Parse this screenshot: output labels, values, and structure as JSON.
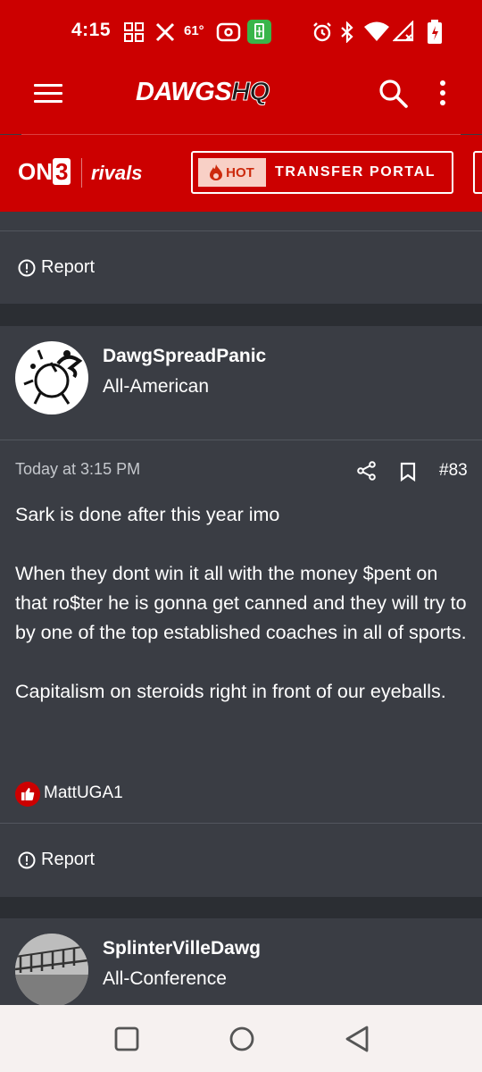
{
  "status_bar": {
    "time": "4:15",
    "temperature": "61°"
  },
  "app_bar": {
    "logo_main": "DAWGS",
    "logo_accent": "HQ"
  },
  "brand_bar": {
    "on3_prefix": "ON",
    "on3_number": "3",
    "rivals": "rivals",
    "hot_label": "HOT",
    "transfer_portal_label": "TRANSFER PORTAL"
  },
  "prev_post": {
    "report_label": "Report"
  },
  "post": {
    "username": "DawgSpreadPanic",
    "user_title": "All-American",
    "timestamp": "Today at 3:15 PM",
    "post_number": "#83",
    "paragraphs": [
      "Sark is done after this year imo",
      "When they dont win it all with the money $pent on that ro$ter he is gonna get canned and they will try to by one of the top established coaches in all of sports.",
      "Capitalism on steroids right in front of our eyeballs."
    ],
    "liked_by": "MattUGA1",
    "report_label": "Report"
  },
  "next_post": {
    "username": "SplinterVilleDawg",
    "user_title": "All-Conference"
  },
  "colors": {
    "brand_red": "#cc0000",
    "post_bg": "#3a3d44",
    "gap_bg": "#2b2e33"
  }
}
